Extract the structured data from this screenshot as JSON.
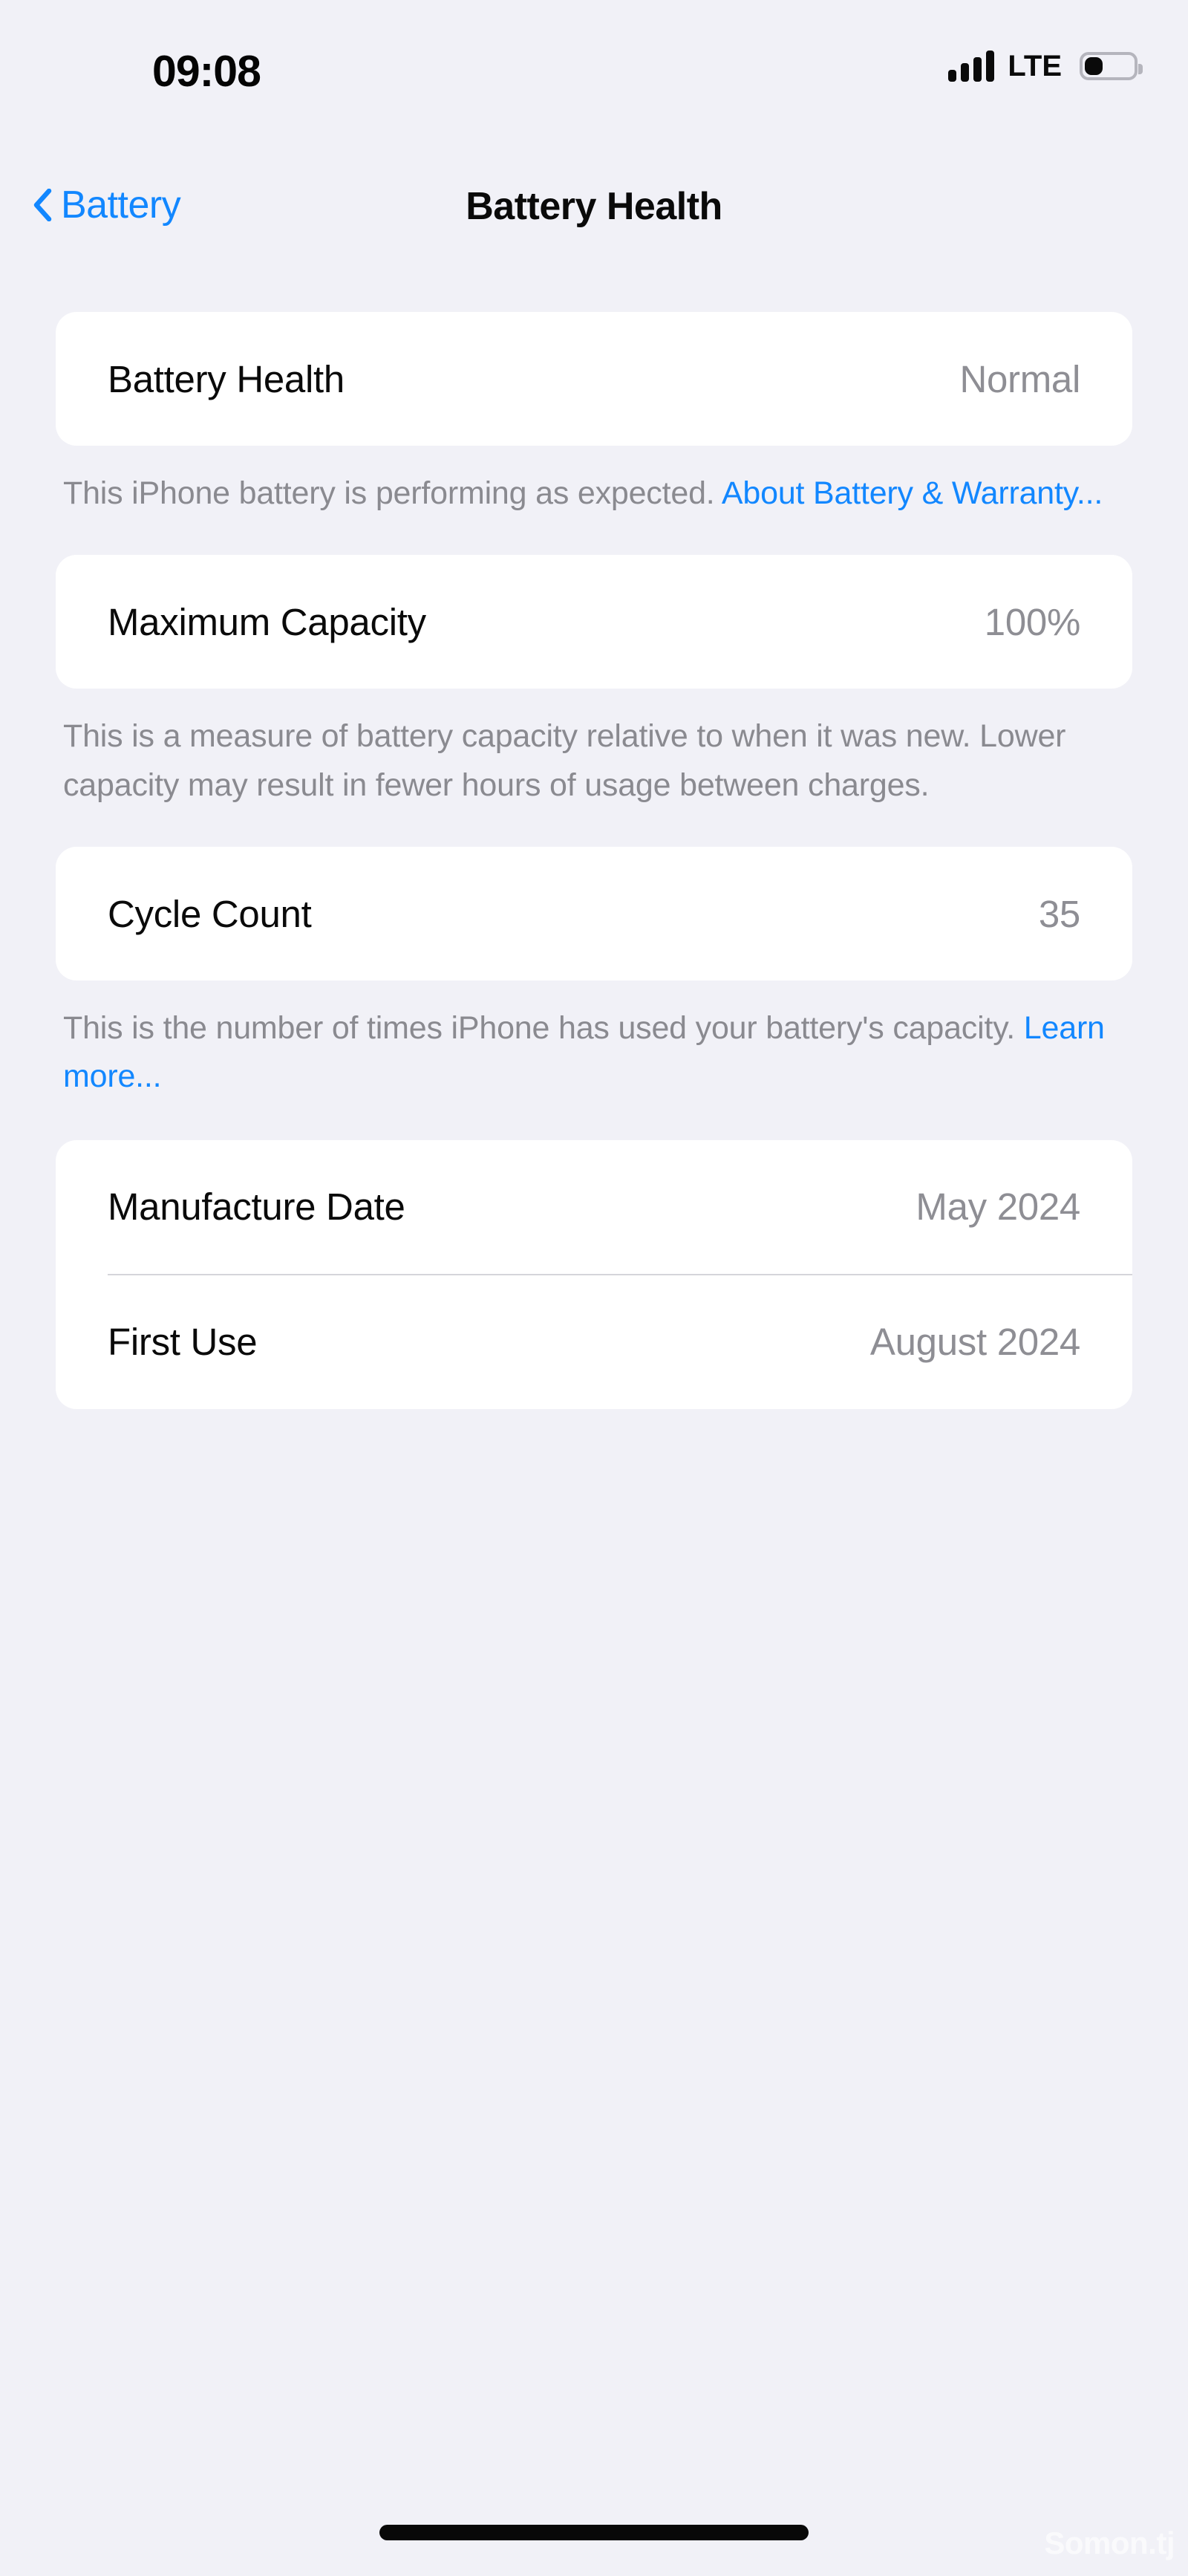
{
  "status_bar": {
    "time": "09:08",
    "network_label": "LTE",
    "signal_bars_filled": 4,
    "signal_bars_total": 4,
    "battery_level_percent": 25,
    "icons": {
      "signal": "signal-bars-icon",
      "battery": "battery-icon"
    }
  },
  "nav": {
    "back_label": "Battery",
    "back_icon": "chevron-left-icon",
    "title": "Battery Health"
  },
  "sections": [
    {
      "rows": [
        {
          "label": "Battery Health",
          "value": "Normal"
        }
      ],
      "footer": {
        "text": "This iPhone battery is performing as expected. ",
        "link": "About Battery & Warranty..."
      }
    },
    {
      "rows": [
        {
          "label": "Maximum Capacity",
          "value": "100%"
        }
      ],
      "footer": {
        "text": "This is a measure of battery capacity relative to when it was new. Lower capacity may result in fewer hours of usage between charges.",
        "link": ""
      }
    },
    {
      "rows": [
        {
          "label": "Cycle Count",
          "value": "35"
        }
      ],
      "footer": {
        "text": "This is the number of times iPhone has used your battery's capacity. ",
        "link": "Learn more..."
      }
    },
    {
      "rows": [
        {
          "label": "Manufacture Date",
          "value": "May 2024"
        },
        {
          "label": "First Use",
          "value": "August 2024"
        }
      ],
      "footer": {
        "text": "",
        "link": ""
      }
    }
  ],
  "watermark": "Somon.tj",
  "colors": {
    "background": "#f1f1f7",
    "card": "#ffffff",
    "accent_blue": "#1287ff",
    "secondary_text": "#8e8e94",
    "footer_text": "#8a8a90",
    "primary_text": "#0a0a0a"
  }
}
